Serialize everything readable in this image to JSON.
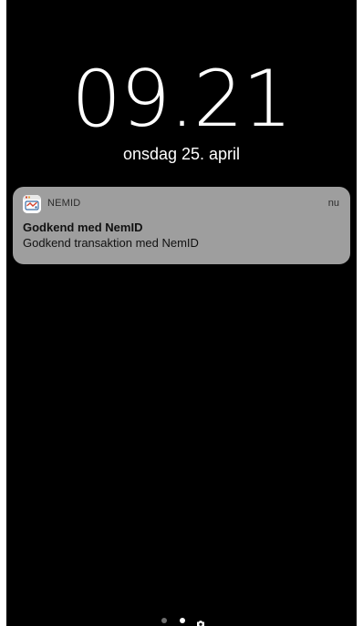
{
  "lockscreen": {
    "time": "09.21",
    "date": "onsdag 25. april"
  },
  "notification": {
    "app_name": "NEMID",
    "app_icon": "nemid-app-icon",
    "time": "nu",
    "title": "Godkend med NemID",
    "body": "Godkend transaktion med NemID"
  },
  "page_indicator": {
    "pages": 2,
    "active_index": 1,
    "trailing_icon": "camera-icon"
  },
  "colors": {
    "background": "#000000",
    "notification_bg": "#9e9e9e",
    "text_primary": "#ffffff"
  }
}
